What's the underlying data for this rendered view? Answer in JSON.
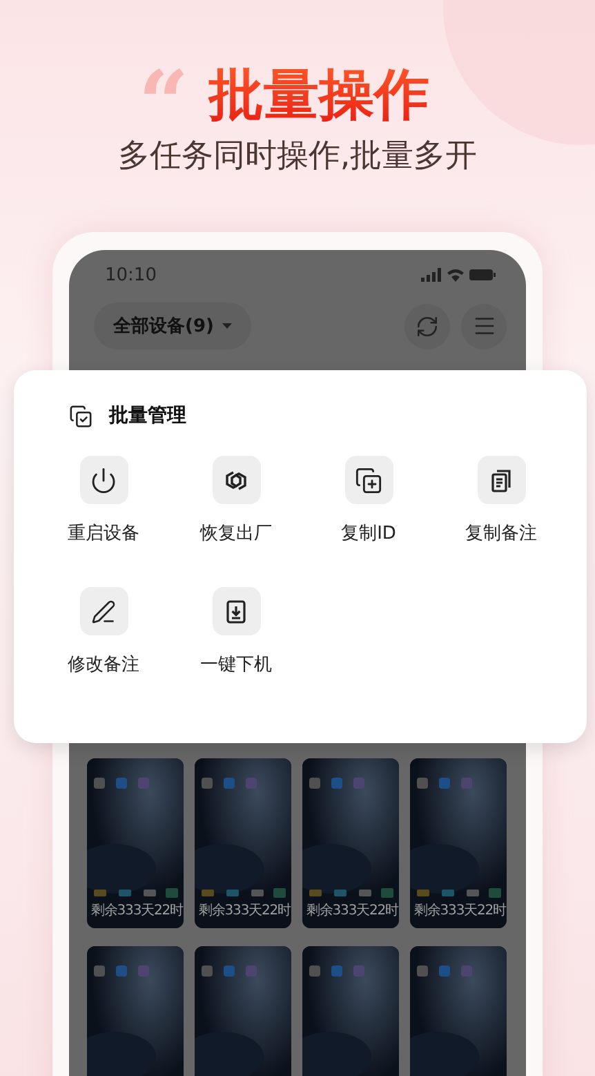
{
  "headline": {
    "quote_mark": "“",
    "title": "批量操作",
    "subtitle": "多任务同时操作,批量多开"
  },
  "phone": {
    "status_bar": {
      "time": "10:10"
    },
    "toolbar": {
      "device_filter": "全部设备(9)"
    },
    "devices": [
      {
        "kind": "labelled",
        "remaining": "剩余333天22时"
      },
      {
        "kind": "labelled",
        "remaining": "剩余333天22时"
      },
      {
        "kind": "labelled",
        "remaining": "剩余333天22时"
      },
      {
        "kind": "labelled",
        "remaining": "剩余333天22时"
      },
      {
        "kind": "plain"
      },
      {
        "kind": "plain"
      },
      {
        "kind": "plain"
      },
      {
        "kind": "plain"
      }
    ]
  },
  "batch_panel": {
    "title": "批量管理",
    "actions": [
      {
        "kind": "power",
        "label": "重启设备"
      },
      {
        "kind": "reset",
        "label": "恢复出厂"
      },
      {
        "kind": "copy_id",
        "label": "复制ID"
      },
      {
        "kind": "copy_note",
        "label": "复制备注"
      },
      {
        "kind": "edit",
        "label": "修改备注"
      },
      {
        "kind": "offline",
        "label": "一键下机"
      }
    ]
  }
}
